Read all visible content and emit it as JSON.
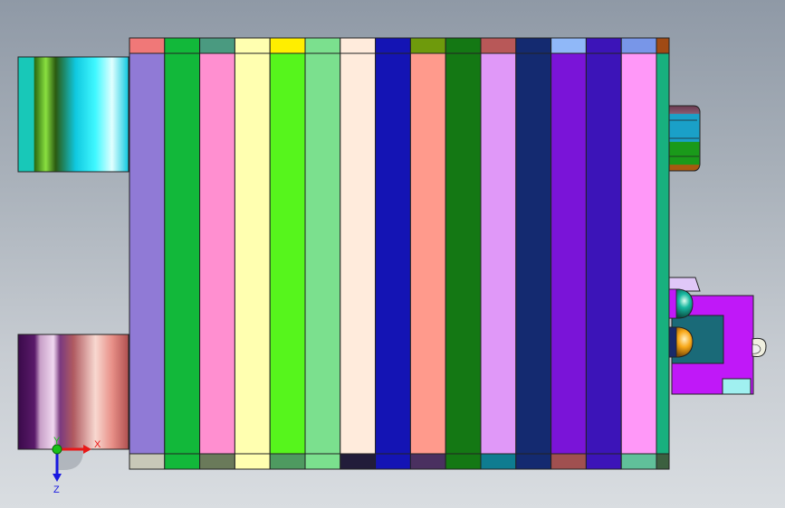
{
  "viewport": {
    "background_top": "#8f99a6",
    "background_bottom": "#d9dde1"
  },
  "model": {
    "columns": [
      {
        "name": "col-1",
        "cap_top": "#f07878",
        "body": "#907ad6",
        "cap_bottom": "#c8c8b8"
      },
      {
        "name": "col-2",
        "cap_top": "#12b83a",
        "body": "#12b83a",
        "cap_bottom": "#12b83a"
      },
      {
        "name": "col-3",
        "cap_top": "#4a9a80",
        "body": "#ff8fd0",
        "cap_bottom": "#6a7a5a"
      },
      {
        "name": "col-4",
        "cap_top": "#ffffb0",
        "body": "#ffffb0",
        "cap_bottom": "#ffffb0"
      },
      {
        "name": "col-5",
        "cap_top": "#ffee00",
        "body": "#56f51c",
        "cap_bottom": "#4e9a60"
      },
      {
        "name": "col-6",
        "cap_top": "#7be08e",
        "body": "#7be08e",
        "cap_bottom": "#7be08e"
      },
      {
        "name": "col-7",
        "cap_top": "#ffebdc",
        "body": "#ffebdc",
        "cap_bottom": "#221c3a"
      },
      {
        "name": "col-8",
        "cap_top": "#1414b4",
        "body": "#1414b4",
        "cap_bottom": "#1414b4"
      },
      {
        "name": "col-9",
        "cap_top": "#6e9a0c",
        "body": "#ff9a8c",
        "cap_bottom": "#4a3060"
      },
      {
        "name": "col-10",
        "cap_top": "#147814",
        "body": "#147814",
        "cap_bottom": "#147814"
      },
      {
        "name": "col-11",
        "cap_top": "#b85858",
        "body": "#e098f8",
        "cap_bottom": "#0e7c90"
      },
      {
        "name": "col-12",
        "cap_top": "#142a70",
        "body": "#142a70",
        "cap_bottom": "#142a70"
      },
      {
        "name": "col-13",
        "cap_top": "#90b8f8",
        "body": "#7a14d8",
        "cap_bottom": "#a05050"
      },
      {
        "name": "col-14",
        "cap_top": "#3c14b8",
        "body": "#3c14b8",
        "cap_bottom": "#3c14b8"
      },
      {
        "name": "col-15",
        "cap_top": "#7896e8",
        "body": "#ff98f8",
        "cap_bottom": "#60c09a"
      }
    ],
    "end_plate": {
      "cap_top": "#a04a14",
      "body": "#18b07e",
      "cap_bottom": "#3c6040"
    },
    "left_block_top": [
      "#18c8b8",
      "#3a7a10",
      "#80e020",
      "#3a7a10",
      "#30f8ff",
      "#10c8e0"
    ],
    "left_block_bottom": [
      "#4a105a",
      "#c8a0c8",
      "#6a3070",
      "#e89088",
      "#f8c8c0",
      "#c06058"
    ],
    "right_stack": [
      "#6a3a50",
      "#1aa0c8",
      "#1a9a1a",
      "#a85a10"
    ],
    "right_assembly": {
      "housing": "#c018f8",
      "window": "#1a6a78",
      "knob_green": "#18b8a0",
      "knob_gold": "#f8a818",
      "knob_cap": "#e0c8f8",
      "tab": "#a0f0f0"
    }
  },
  "triad": {
    "x_label": "X",
    "y_label": "Y",
    "z_label": "Z",
    "x_color": "#e81818",
    "y_color": "#18c018",
    "z_color": "#1818e0"
  }
}
